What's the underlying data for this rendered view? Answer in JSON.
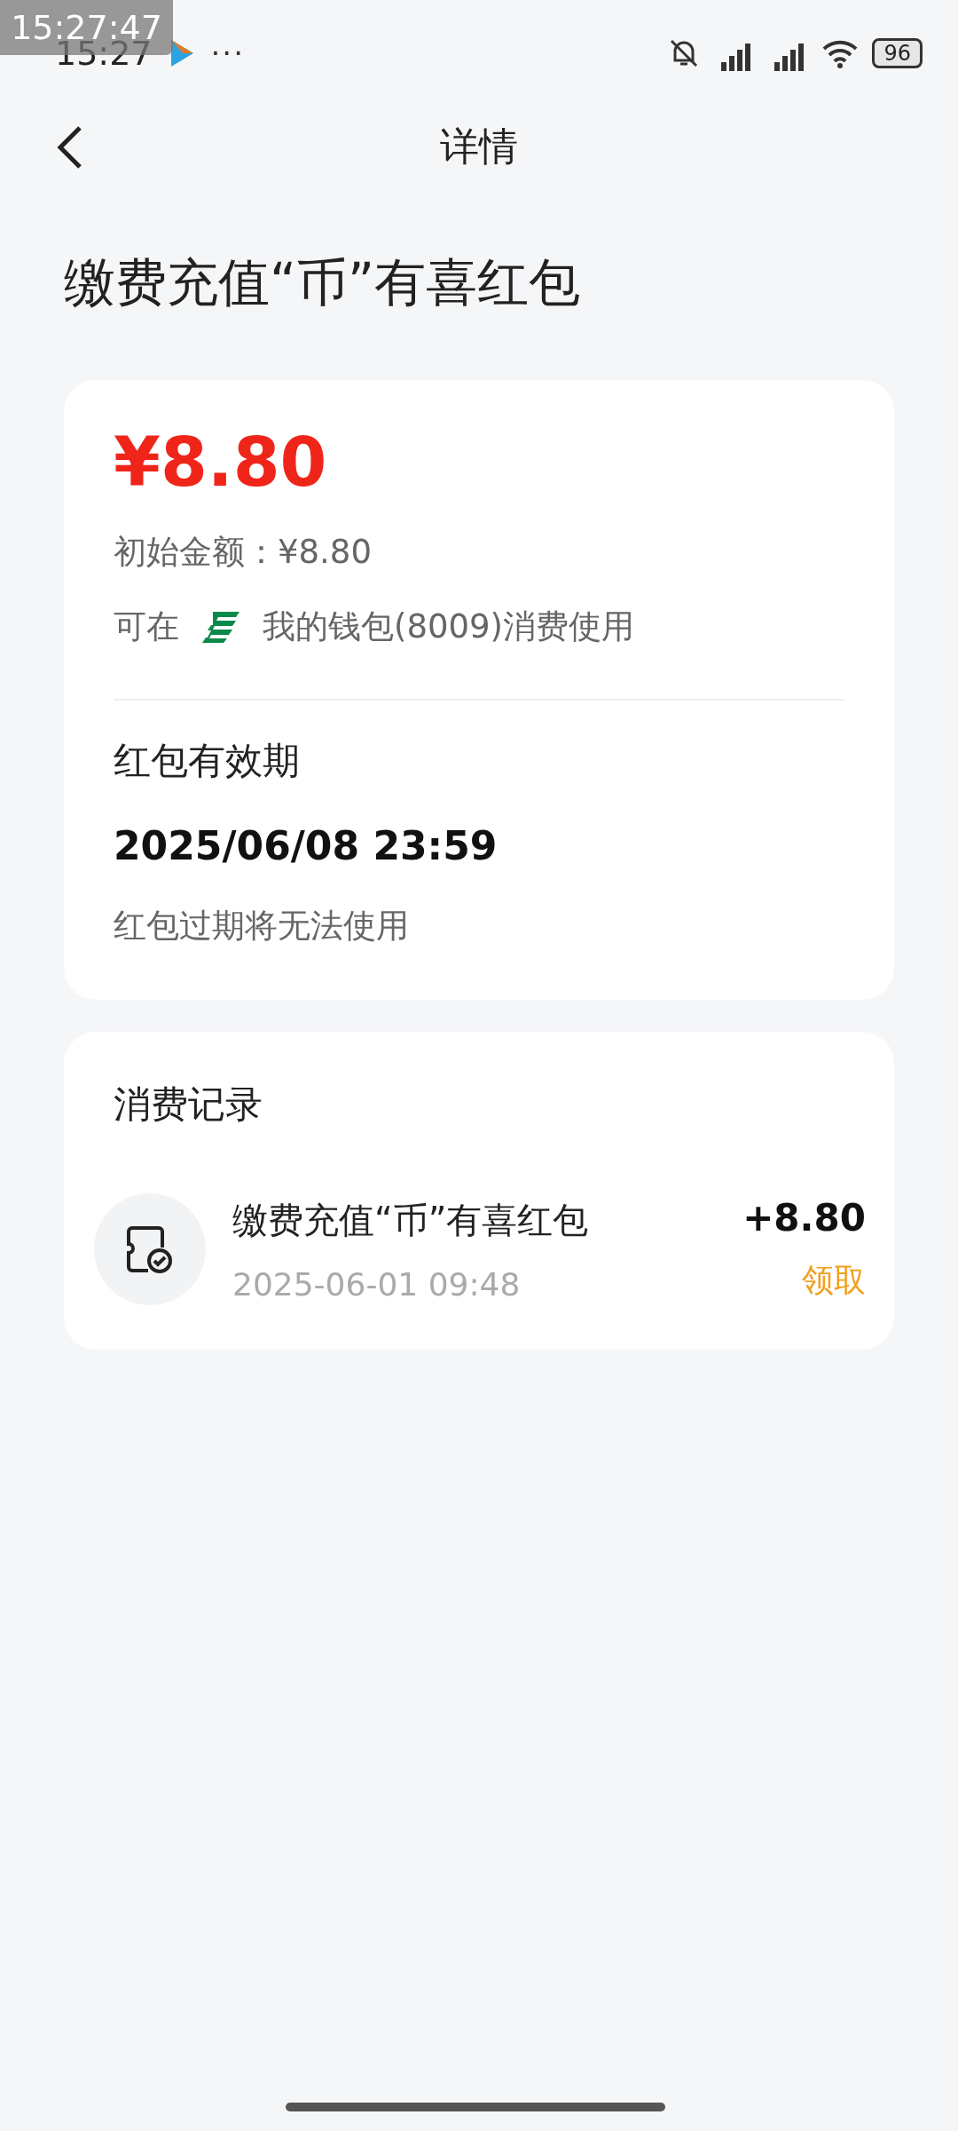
{
  "recording_time": "15:27:47",
  "status_bar": {
    "time": "15:27",
    "more": "···",
    "battery": "96"
  },
  "nav": {
    "title": "详情"
  },
  "heading": "缴费充值“币”有喜红包",
  "summary": {
    "amount": "¥8.80",
    "initial_amount": "初始金额：¥8.80",
    "usage_prefix": "可在",
    "usage_text": "我的钱包(8009)消费使用",
    "validity_label": "红包有效期",
    "validity_date": "2025/06/08 23:59",
    "validity_note": "红包过期将无法使用"
  },
  "records": {
    "title": "消费记录",
    "items": [
      {
        "title": "缴费充值“币”有喜红包",
        "time": "2025-06-01 09:48",
        "amount": "+8.80",
        "action": "领取"
      }
    ]
  }
}
